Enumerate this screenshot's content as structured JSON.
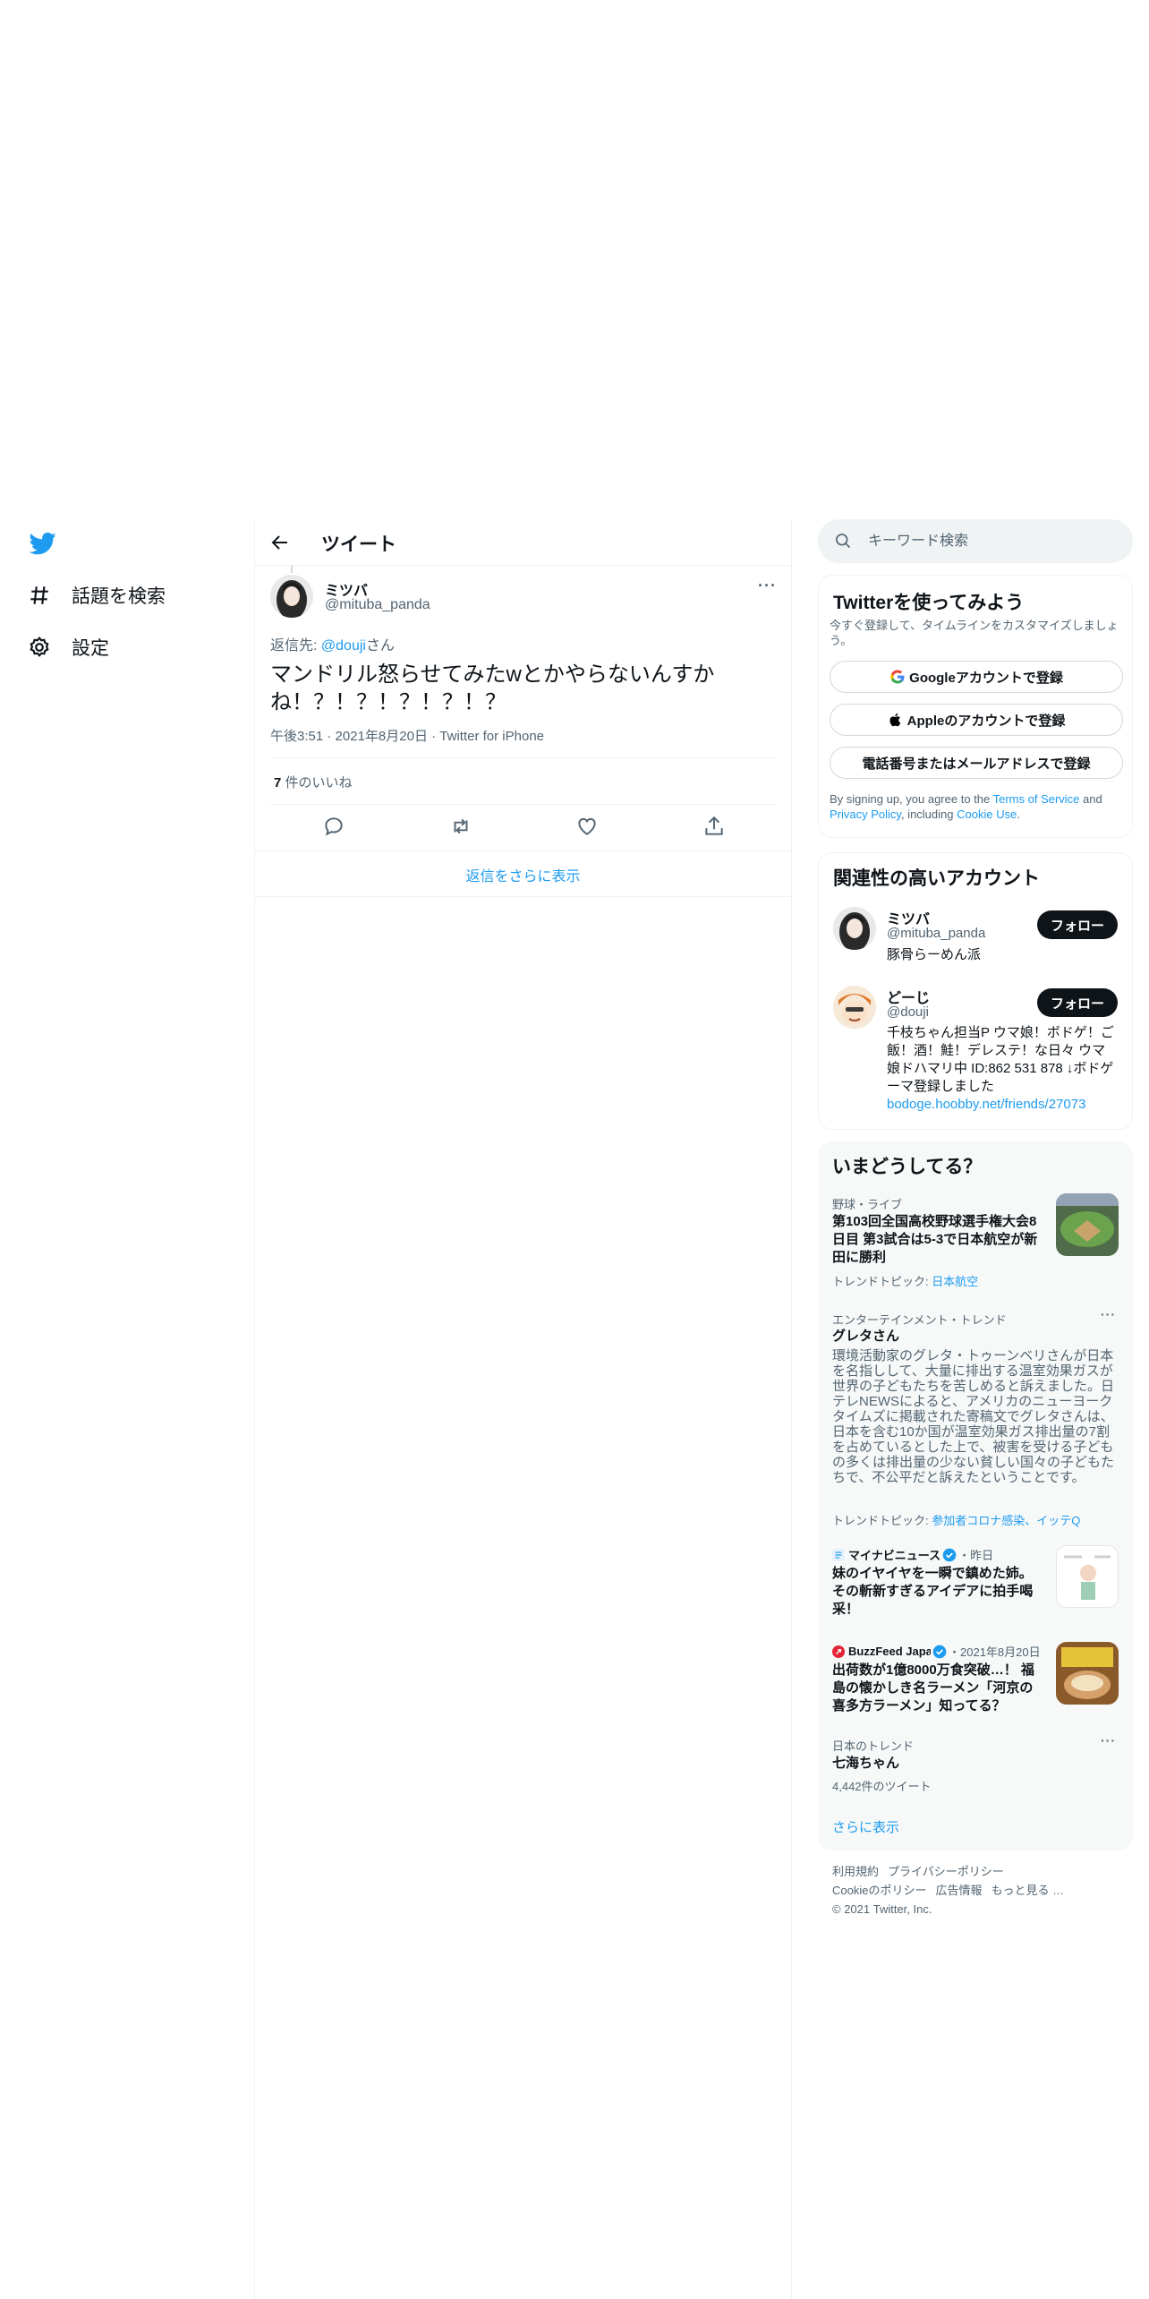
{
  "nav": {
    "explore_label": "話題を検索",
    "settings_label": "設定"
  },
  "header": {
    "title": "ツイート"
  },
  "tweet": {
    "author_name": "ミツバ",
    "author_handle": "@mituba_panda",
    "more": "···",
    "reply_prefix": "返信先: ",
    "reply_handle": "@douji",
    "reply_suffix": "さん",
    "text": "マンドリル怒らせてみたwとかやらないんすかね！？！？！？！？！？",
    "time": "午後3:51",
    "date": "2021年8月20日",
    "client": "Twitter for iPhone",
    "likes_count": "7",
    "likes_label": " 件のいいね",
    "show_more_replies": "返信をさらに表示"
  },
  "search": {
    "placeholder": "キーワード検索"
  },
  "signup": {
    "title": "Twitterを使ってみよう",
    "subtitle": "今すぐ登録して、タイムラインをカスタマイズしましょう。",
    "google_label": "Googleアカウントで登録",
    "apple_label": "Appleのアカウントで登録",
    "phone_label": "電話番号またはメールアドレスで登録",
    "legal_1": "By signing up, you agree to the ",
    "legal_tos": "Terms of Service",
    "legal_2": " and ",
    "legal_privacy": "Privacy Policy",
    "legal_3": ", including ",
    "legal_cookie": "Cookie Use",
    "legal_4": "."
  },
  "relevant": {
    "title": "関連性の高いアカウント",
    "accounts": [
      {
        "name": "ミツバ",
        "handle": "@mituba_panda",
        "bio": "豚骨らーめん派",
        "follow_label": "フォロー"
      },
      {
        "name": "どーじ",
        "handle": "@douji",
        "bio": "千枝ちゃん担当P ウマ娘！ボドゲ！ご飯！酒！鮭！デレステ！な日々 ウマ娘ドハマリ中 ID:862 531 878 ↓ボドゲーマ登録しました",
        "link": "bodoge.hoobby.net/friends/27073",
        "follow_label": "フォロー"
      }
    ]
  },
  "trends": {
    "title": "いまどうしてる？",
    "items": [
      {
        "category": "野球・ライブ",
        "title": "第103回全国高校野球選手権大会8日目 第3試合は5-3で日本航空が新田に勝利",
        "topic_label": "トレンドトピック: ",
        "topic": "日本航空"
      },
      {
        "category": "エンターテインメント・トレンド",
        "title": "グレタさん",
        "description": "環境活動家のグレタ・トゥーンベリさんが日本を名指しして、大量に排出する温室効果ガスが世界の子どもたちを苦しめると訴えました。日テレNEWSによると、アメリカのニューヨークタイムズに掲載された寄稿文でグレタさんは、日本を含む10か国が温室効果ガス排出量の7割を占めているとした上で、被害を受ける子どもの多くは排出量の少ない貧しい国々の子どもたちで、不公平だと訴えたということです。",
        "topic_label": "トレンドトピック: ",
        "topic": "参加者コロナ感染、イッテQ"
      },
      {
        "source": "マイナビニュース",
        "time": "・昨日",
        "title": "妹のイヤイヤを一瞬で鎮めた姉。その斬新すぎるアイデアに拍手喝采！"
      },
      {
        "source": "BuzzFeed Japan",
        "time": "・2021年8月20日",
        "title": "出荷数が1億8000万食突破…！ 福島の懐かしき名ラーメン「河京の喜多方ラーメン」知ってる？"
      },
      {
        "category": "日本のトレンド",
        "title": "七海ちゃん",
        "count": "4,442件のツイート"
      }
    ],
    "show_more": "さらに表示"
  },
  "footer": {
    "links": [
      "利用規約",
      "プライバシーポリシー",
      "Cookieのポリシー",
      "広告情報",
      "もっと見る …"
    ],
    "copyright": "© 2021 Twitter, Inc."
  },
  "colors": {
    "accent": "#1d9bf0",
    "text": "#0f1419",
    "secondary": "#536471",
    "border": "#eff3f4"
  }
}
